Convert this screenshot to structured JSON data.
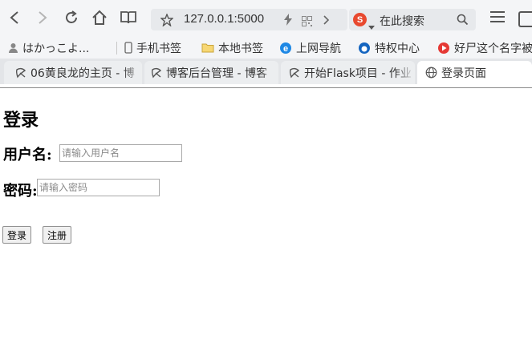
{
  "toolbar": {
    "address": "127.0.0.1:5000",
    "search_logo": "S",
    "search_text": "在此搜索"
  },
  "bookmarks": [
    {
      "label": "はかっこよ...",
      "icon": "person-icon"
    },
    {
      "label": "手机书签",
      "icon": "phone-icon"
    },
    {
      "label": "本地书签",
      "icon": "folder-icon"
    },
    {
      "label": "上网导航",
      "icon": "ie-icon"
    },
    {
      "label": "特权中心",
      "icon": "privilege-icon"
    },
    {
      "label": "好尸这个名字被",
      "icon": "play-icon"
    }
  ],
  "tabs": [
    {
      "label": "06黄良龙的主页 - 博",
      "icon": "site-icon",
      "active": false
    },
    {
      "label": "博客后台管理 - 博客",
      "icon": "site-icon",
      "active": false
    },
    {
      "label": "开始Flask项目 - 作业",
      "icon": "site-icon",
      "active": false
    },
    {
      "label": "登录页面",
      "icon": "globe-icon",
      "active": true
    }
  ],
  "page": {
    "title": "登录",
    "username_label": "用户名:",
    "username_placeholder": "请输入用户名",
    "password_label": "密码:",
    "password_placeholder": "请输入密码",
    "login_button": "登录",
    "register_button": "注册"
  },
  "colors": {
    "search_logo": "#e8492f",
    "ie_blue": "#1e88e5",
    "tab_active": "#ffffff",
    "chrome_bg": "#f4f5f7"
  }
}
